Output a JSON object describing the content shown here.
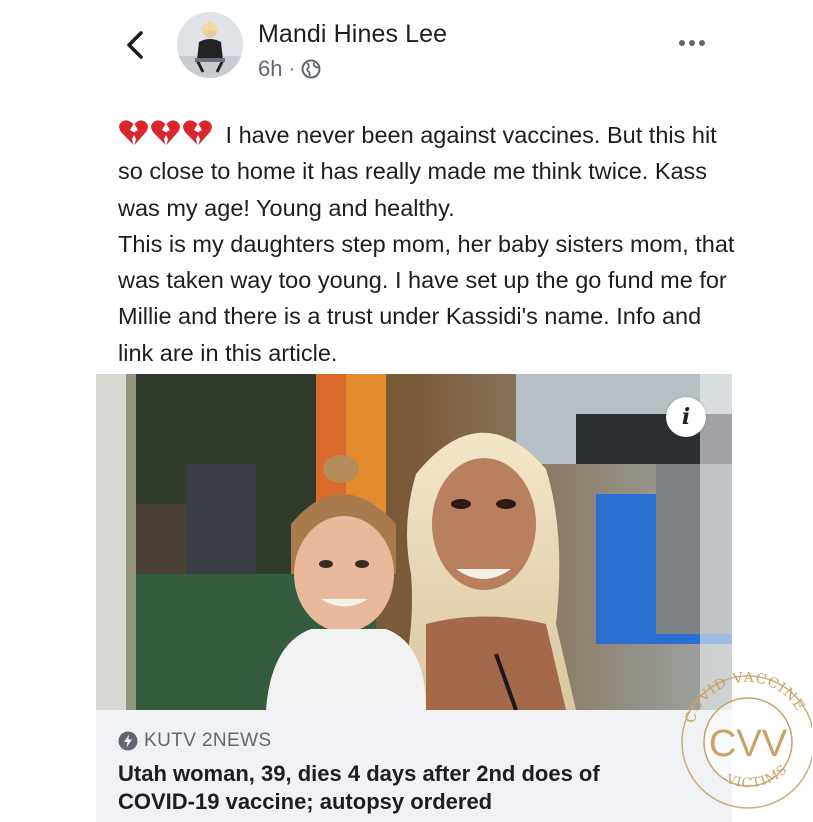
{
  "header": {
    "author_name": "Mandi Hines Lee",
    "timestamp": "6h",
    "separator": "·",
    "privacy_icon": "globe-icon",
    "back_icon": "chevron-left-icon",
    "more_icon": "more-horizontal-icon"
  },
  "post": {
    "emojis": [
      "💔",
      "💔",
      "💔"
    ],
    "text": " I have never been against vaccines. But this hit so close to home it has really made me think twice. Kass was my age! Young and healthy.\n This is my daughters step mom, her baby sisters mom, that was taken way too young. I have set up the go fund me for Millie and there is a trust under Kassidi's name. Info and link are in this article."
  },
  "link_preview": {
    "info_label": "i",
    "source": "KUTV 2NEWS",
    "source_icon": "lightning-icon",
    "title": "Utah woman, 39, dies 4 days after 2nd does of COVID-19 vaccine; autopsy ordered"
  },
  "watermark": {
    "center_text": "CVV",
    "arc_top": "COVID VACCINE",
    "arc_bottom": "VICTIMS",
    "color": "#c9a26a"
  },
  "colors": {
    "text": "#1c1e21",
    "secondary": "#606770",
    "card_bg": "#f0f2f5"
  }
}
